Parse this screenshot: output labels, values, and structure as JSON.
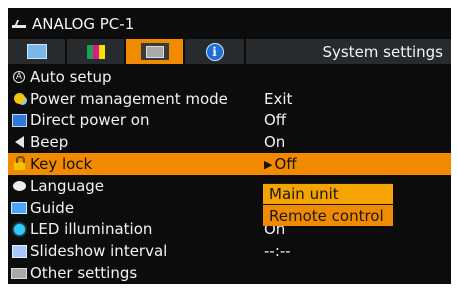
{
  "header": {
    "source_title": "ANALOG PC-1",
    "source_icon": "analog-input-icon"
  },
  "tabs": [
    {
      "icon": "monitor-icon",
      "active": false
    },
    {
      "icon": "color-icon",
      "active": false
    },
    {
      "icon": "settings-icon",
      "active": true
    },
    {
      "icon": "info-icon",
      "active": false,
      "glyph": "i"
    }
  ],
  "menu_title": "System settings",
  "menu": [
    {
      "icon": "auto-setup-icon",
      "glyph": "A",
      "label": "Auto setup",
      "value": ""
    },
    {
      "icon": "power-management-icon",
      "label": "Power management mode",
      "value": "Exit"
    },
    {
      "icon": "direct-power-icon",
      "label": "Direct power on",
      "value": "Off"
    },
    {
      "icon": "speaker-icon",
      "label": "Beep",
      "value": "On"
    },
    {
      "icon": "lock-icon",
      "label": "Key lock",
      "value": "Off",
      "pointer": "▶",
      "selected": true
    },
    {
      "icon": "language-icon",
      "label": "Language",
      "value": ""
    },
    {
      "icon": "guide-icon",
      "label": "Guide",
      "value": ""
    },
    {
      "icon": "led-icon",
      "label": "LED illumination",
      "value": "On"
    },
    {
      "icon": "slideshow-icon",
      "label": "Slideshow interval",
      "value": "--:--"
    },
    {
      "icon": "other-settings-icon",
      "label": "Other settings",
      "value": ""
    }
  ],
  "key_lock_options": [
    "Main unit",
    "Remote control"
  ],
  "colors": {
    "accent": "#f28a00",
    "background": "#0c0c0c",
    "tab_bg": "#272b2e"
  }
}
